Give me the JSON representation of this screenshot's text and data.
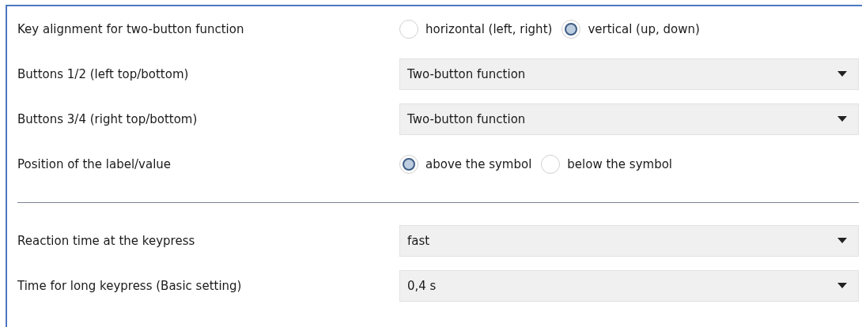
{
  "rows": [
    {
      "kind": "radio",
      "label": "Key alignment for two-button function",
      "options": [
        {
          "label": "horizontal (left, right)",
          "selected": false
        },
        {
          "label": "vertical (up, down)",
          "selected": true
        }
      ]
    },
    {
      "kind": "select",
      "label": "Buttons 1/2 (left top/bottom)",
      "value": "Two-button function"
    },
    {
      "kind": "select",
      "label": "Buttons 3/4 (right top/bottom)",
      "value": "Two-button function"
    },
    {
      "kind": "radio",
      "label": "Position of the label/value",
      "options": [
        {
          "label": "above the symbol",
          "selected": true
        },
        {
          "label": "below the symbol",
          "selected": false
        }
      ]
    },
    {
      "kind": "divider"
    },
    {
      "kind": "select",
      "label": "Reaction time at the keypress",
      "value": "fast"
    },
    {
      "kind": "select",
      "label": "Time for long keypress (Basic setting)",
      "value": "0,4 s"
    }
  ]
}
